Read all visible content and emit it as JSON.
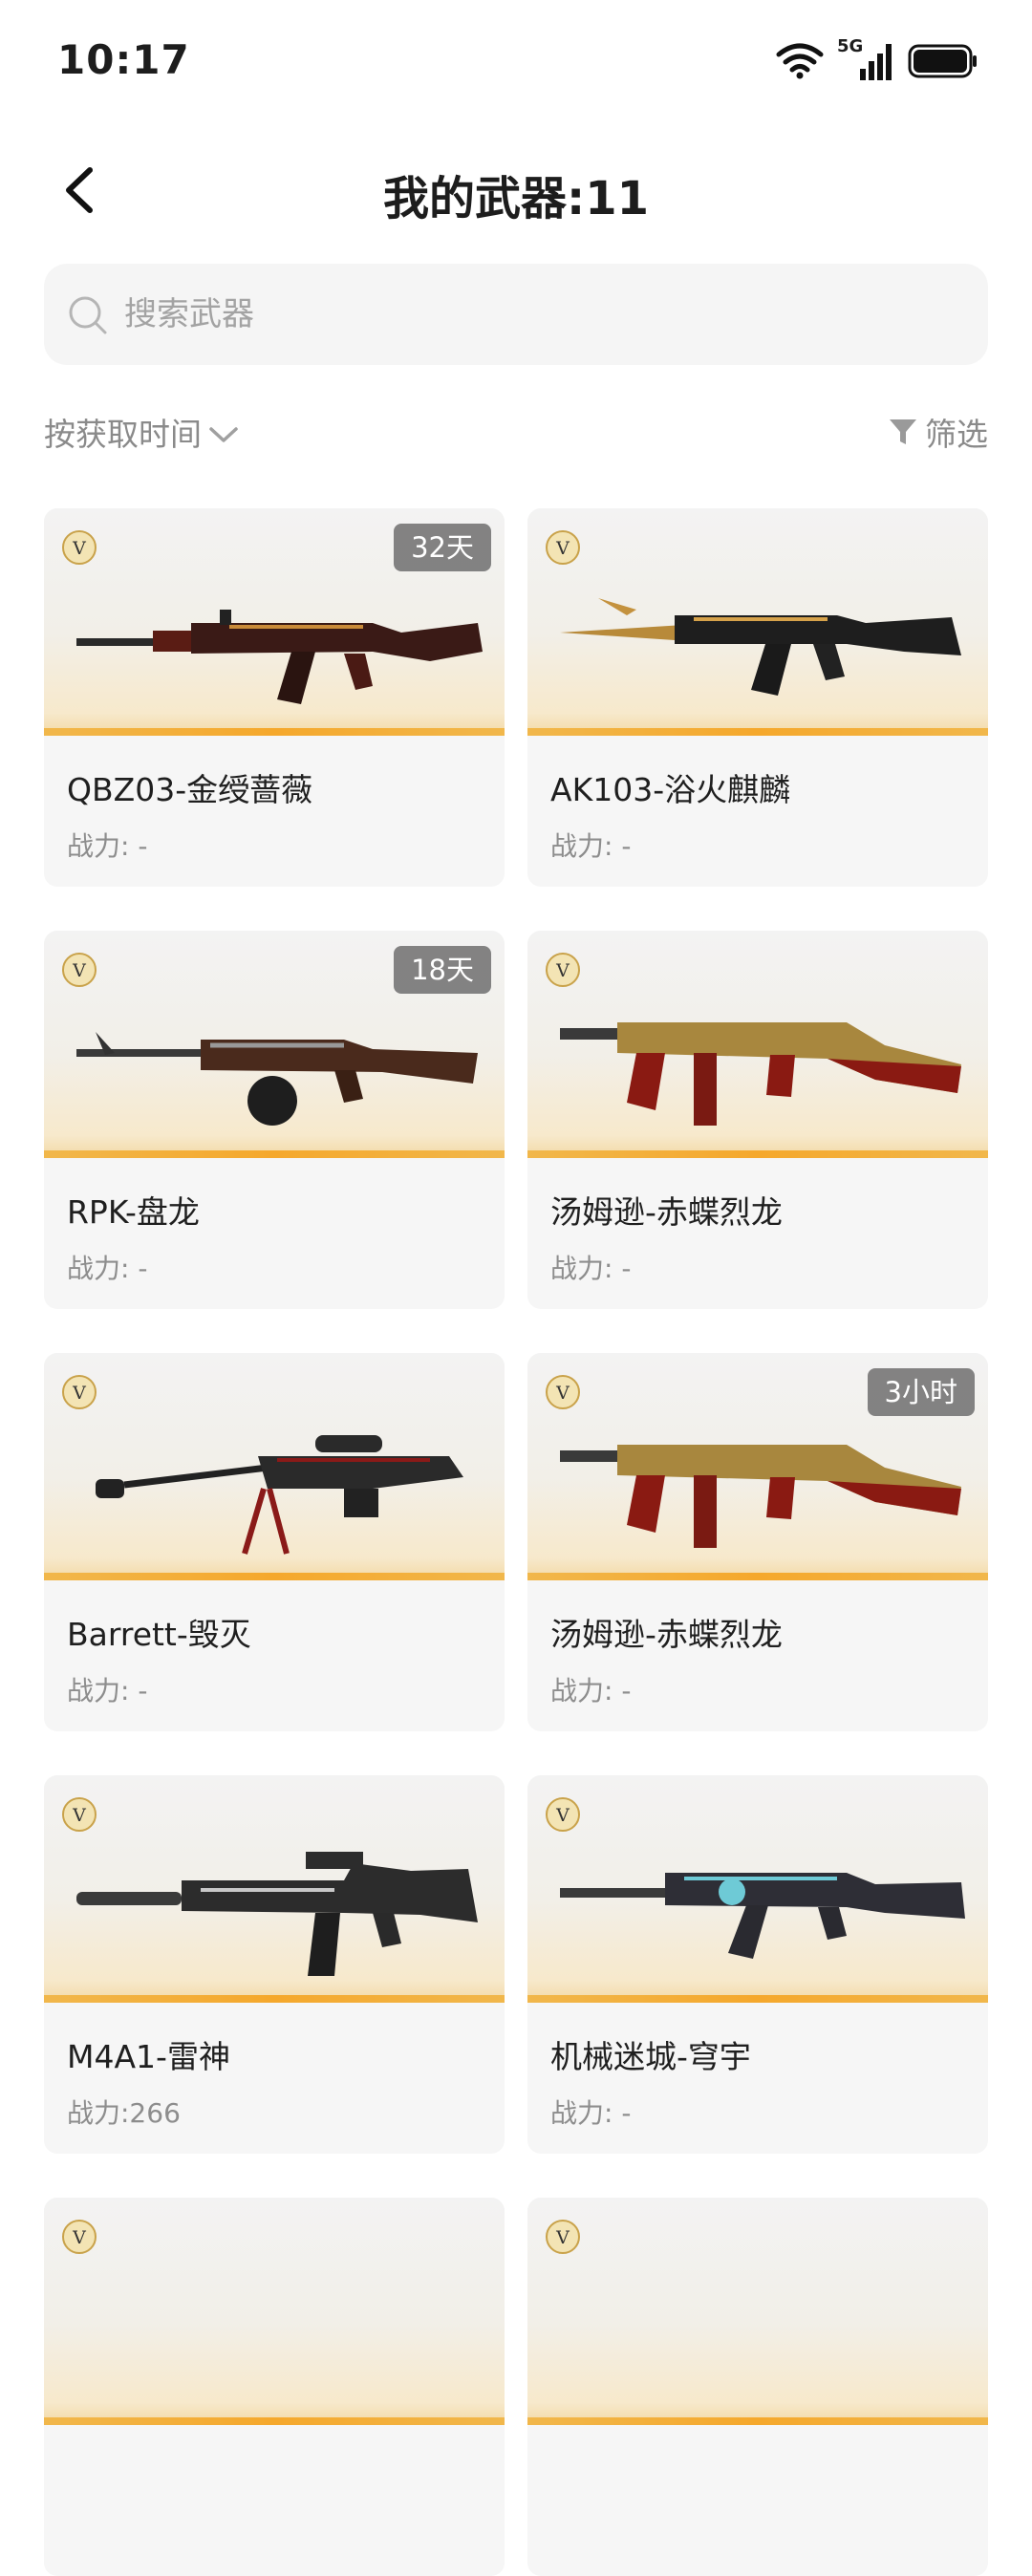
{
  "status_bar": {
    "time": "10:17",
    "network": "5G"
  },
  "header": {
    "title": "我的武器:11"
  },
  "search": {
    "placeholder": "搜索武器"
  },
  "toolbar": {
    "sort_label": "按获取时间",
    "filter_label": "筛选"
  },
  "colors": {
    "accent_gold": "#f5a82c",
    "badge_bg": "#6e6e6e",
    "card_bg": "#f6f6f6"
  },
  "weapons": [
    {
      "name": "QBZ03-金绶蔷薇",
      "power": "战力: -",
      "badge": "32天",
      "icon": "rifle-icon"
    },
    {
      "name": "AK103-浴火麒麟",
      "power": "战力: -",
      "badge": "",
      "icon": "rifle-icon"
    },
    {
      "name": "RPK-盘龙",
      "power": "战力: -",
      "badge": "18天",
      "icon": "machine-gun-icon"
    },
    {
      "name": "汤姆逊-赤蝶烈龙",
      "power": "战力: -",
      "badge": "",
      "icon": "smg-icon"
    },
    {
      "name": "Barrett-毁灭",
      "power": "战力: -",
      "badge": "",
      "icon": "sniper-rifle-icon"
    },
    {
      "name": "汤姆逊-赤蝶烈龙",
      "power": "战力: -",
      "badge": "3小时",
      "icon": "smg-icon"
    },
    {
      "name": "M4A1-雷神",
      "power": "战力:266",
      "badge": "",
      "icon": "rifle-icon"
    },
    {
      "name": "机械迷城-穹宇",
      "power": "战力: -",
      "badge": "",
      "icon": "rifle-icon"
    },
    {
      "name": "",
      "power": "",
      "badge": "",
      "icon": "weapon-icon"
    },
    {
      "name": "",
      "power": "",
      "badge": "",
      "icon": "weapon-icon"
    }
  ]
}
